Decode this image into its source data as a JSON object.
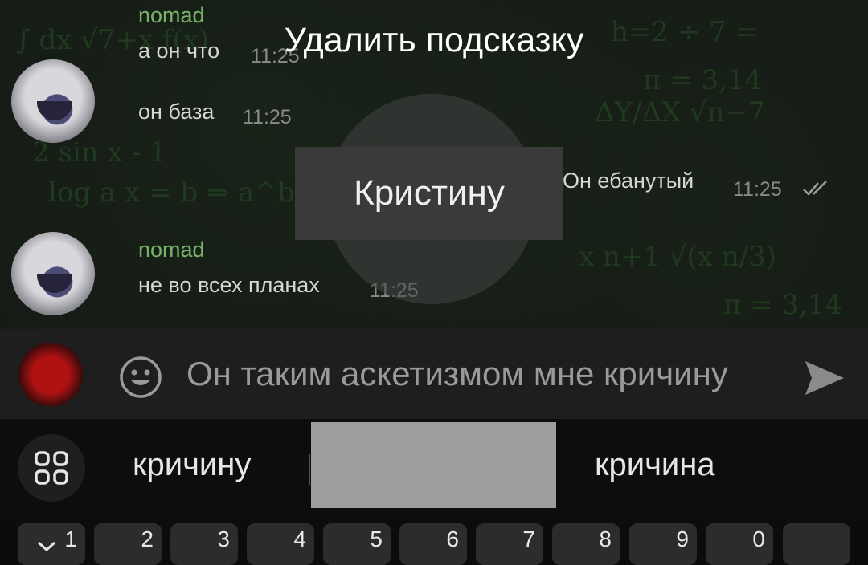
{
  "tooltip": {
    "title": "Удалить подсказку"
  },
  "preview": {
    "word": "Кристину"
  },
  "messages": [
    {
      "sender": "nomad",
      "text": "а он что",
      "time": "11:25"
    },
    {
      "text": "он база",
      "time": "11:25"
    },
    {
      "text": "Он ебанутый",
      "time": "11:25",
      "outgoing": true,
      "status": "read"
    },
    {
      "sender": "nomad",
      "text": "не во всех планах",
      "time": "11:25"
    }
  ],
  "composer": {
    "text": "Он таким аскетизмом мне кричину"
  },
  "suggestions": [
    "кричину",
    "",
    "кричина"
  ],
  "keys": [
    "1",
    "2",
    "3",
    "4",
    "5",
    "6",
    "7",
    "8",
    "9",
    "0",
    ""
  ],
  "icons": {
    "emoji": "smiley-icon",
    "send": "send-arrow-icon",
    "apps": "apps-grid-icon",
    "read": "double-check-icon",
    "collapse": "chevron-down-icon"
  },
  "colors": {
    "sender_name": "#79b36a",
    "background": "#151915"
  }
}
